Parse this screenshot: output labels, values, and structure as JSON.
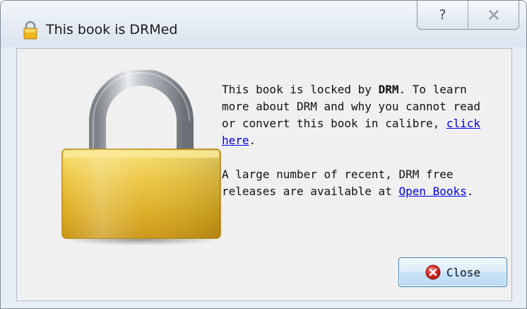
{
  "window": {
    "title": "This book is DRMed",
    "help_glyph": "?",
    "close_glyph": "✕",
    "title_icon": "padlock-icon"
  },
  "message": {
    "para1_prefix": "This book is locked by ",
    "para1_bold": "DRM",
    "para1_middle": ". To learn more about DRM and why you cannot read or convert this book in calibre, ",
    "para1_link": "click here",
    "para1_suffix": ".",
    "para2_prefix": "A large number of recent, DRM free releases are available at ",
    "para2_link": "Open Books",
    "para2_suffix": "."
  },
  "buttons": {
    "close_label": "Close",
    "close_icon": "red-x-circle-icon"
  },
  "colors": {
    "link": "#0000ee",
    "padlock_gold": "#e8c23a",
    "close_icon_red": "#d9302b"
  }
}
